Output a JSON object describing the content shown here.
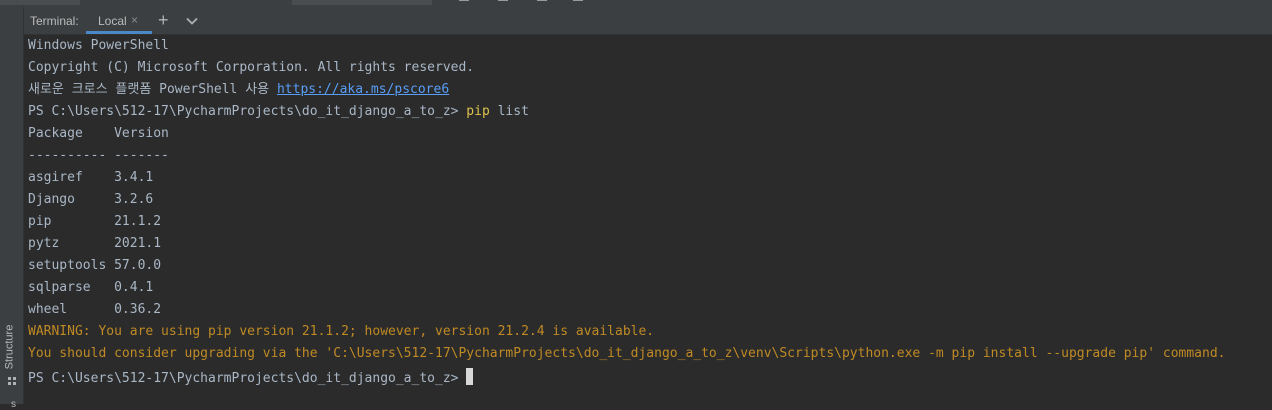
{
  "tool_window": {
    "label": "Terminal:",
    "tabs": [
      {
        "label": "Local",
        "close": "×"
      }
    ],
    "new_tab": "+",
    "side_tab": "Structure",
    "side_tab_2": "s"
  },
  "terminal": {
    "line0": "Windows PowerShell",
    "line1": "Copyright (C) Microsoft Corporation. All rights reserved.",
    "line2_prefix": "새로운 크로스 플랫폼 PowerShell 사용 ",
    "line2_link": "https://aka.ms/pscore6",
    "prompt": "PS C:\\Users\\512-17\\PycharmProjects\\do_it_django_a_to_z> ",
    "cmd1_name": "pip",
    "cmd1_args": " list",
    "header": "Package    Version",
    "separator": "---------- -------",
    "packages": [
      {
        "text": "asgiref    3.4.1"
      },
      {
        "text": "Django     3.2.6"
      },
      {
        "text": "pip        21.1.2"
      },
      {
        "text": "pytz       2021.1"
      },
      {
        "text": "setuptools 57.0.0"
      },
      {
        "text": "sqlparse   0.4.1"
      },
      {
        "text": "wheel      0.36.2"
      }
    ],
    "warning1": "WARNING: You are using pip version 21.1.2; however, version 21.2.4 is available.",
    "warning2": "You should consider upgrading via the 'C:\\Users\\512-17\\PycharmProjects\\do_it_django_a_to_z\\venv\\Scripts\\python.exe -m pip install --upgrade pip' command.",
    "prompt2": "PS C:\\Users\\512-17\\PycharmProjects\\do_it_django_a_to_z> "
  },
  "colors": {
    "background": "#2b2b2b",
    "text": "#a9b7c6",
    "warning": "#bf8a24",
    "link": "#589df6",
    "command": "#dcc04e",
    "tab_underline": "#4a88c7"
  }
}
